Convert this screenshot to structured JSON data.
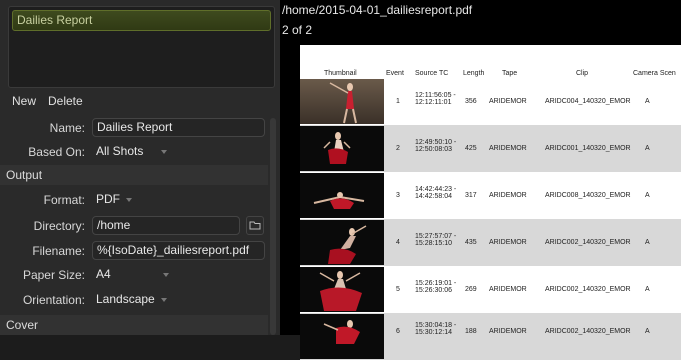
{
  "left": {
    "list_items": [
      "Dailies Report"
    ],
    "buttons": {
      "new": "New",
      "delete": "Delete"
    },
    "name": {
      "label": "Name:",
      "value": "Dailies Report"
    },
    "based_on": {
      "label": "Based On:",
      "value": "All Shots"
    },
    "sections": {
      "output": "Output",
      "cover": "Cover"
    },
    "format": {
      "label": "Format:",
      "value": "PDF"
    },
    "directory": {
      "label": "Directory:",
      "value": "/home"
    },
    "filename": {
      "label": "Filename:",
      "value": "%{IsoDate}_dailiesreport.pdf"
    },
    "paper_size": {
      "label": "Paper Size:",
      "value": "A4"
    },
    "orientation": {
      "label": "Orientation:",
      "value": "Landscape"
    }
  },
  "preview": {
    "path": "/home/2015-04-01_dailiesreport.pdf",
    "page_indicator": "2 of 2",
    "columns": [
      "Thumbnail",
      "Event",
      "Source TC",
      "Length",
      "Tape",
      "Clip",
      "Camera Scen"
    ],
    "rows": [
      {
        "event": "1",
        "tc_in": "12:11:56:05 -",
        "tc_out": "12:12:11:01",
        "length": "356",
        "tape": "ARIDEMOR",
        "clip": "ARIDC004_140320_EMOR",
        "camera": "A"
      },
      {
        "event": "2",
        "tc_in": "12:49:50:10 -",
        "tc_out": "12:50:08:03",
        "length": "425",
        "tape": "ARIDEMOR",
        "clip": "ARIDC001_140320_EMOR",
        "camera": "A"
      },
      {
        "event": "3",
        "tc_in": "14:42:44:23 -",
        "tc_out": "14:42:58:04",
        "length": "317",
        "tape": "ARIDEMOR",
        "clip": "ARIDC008_140320_EMOR",
        "camera": "A"
      },
      {
        "event": "4",
        "tc_in": "15:27:57:07 -",
        "tc_out": "15:28:15:10",
        "length": "435",
        "tape": "ARIDEMOR",
        "clip": "ARIDC002_140320_EMOR",
        "camera": "A"
      },
      {
        "event": "5",
        "tc_in": "15:26:19:01 -",
        "tc_out": "15:26:30:06",
        "length": "269",
        "tape": "ARIDEMOR",
        "clip": "ARIDC002_140320_EMOR",
        "camera": "A"
      },
      {
        "event": "6",
        "tc_in": "15:30:04:18 -",
        "tc_out": "15:30:12:14",
        "length": "188",
        "tape": "ARIDEMOR",
        "clip": "ARIDC002_140320_EMOR",
        "camera": "A"
      }
    ]
  },
  "icons": {
    "folder": "folder-icon",
    "dropdown": "chevron-down-icon",
    "thumbnail": "dancer-thumbnail-image"
  },
  "colors": {
    "selection": "#3e4a1e",
    "row_shade": "#d8d8d8",
    "thumb_red": "#b01020"
  }
}
